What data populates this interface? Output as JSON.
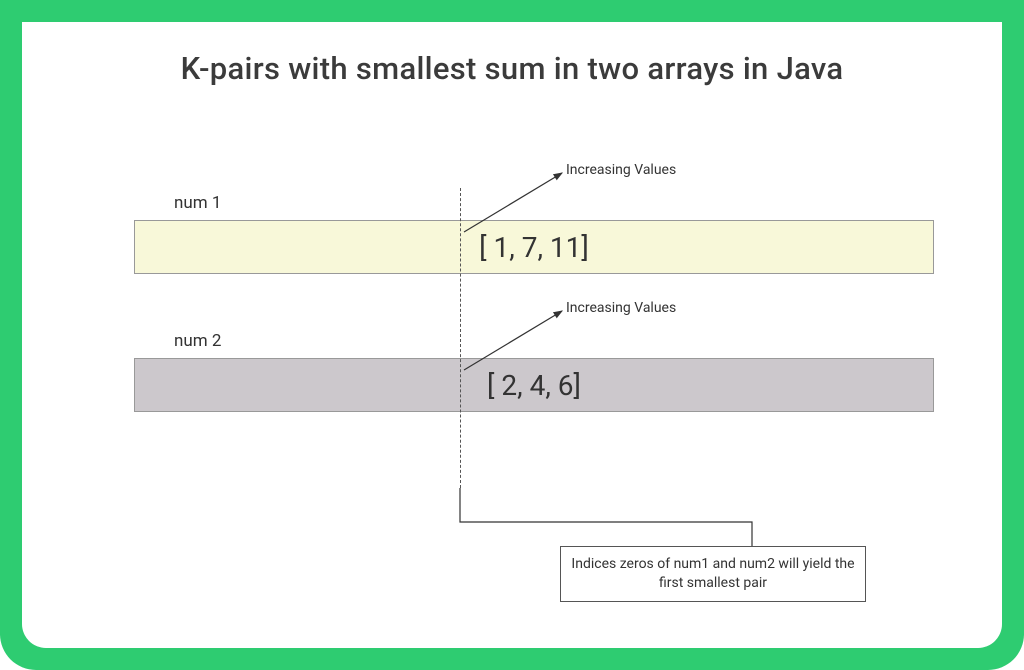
{
  "title": "K-pairs with smallest sum in two arrays in Java",
  "num1": {
    "label": "num 1",
    "values_text": "[ 1, 7, 11]",
    "values": [
      1,
      7,
      11
    ]
  },
  "num2": {
    "label": "num 2",
    "values_text": "[ 2, 4, 6]",
    "values": [
      2,
      4,
      6
    ]
  },
  "annotation_increasing": "Increasing Values",
  "callout_text": "Indices zeros of num1 and num2 will yield the first smallest pair",
  "colors": {
    "frame": "#2ecc71",
    "bar_num1": "#f8f8d9",
    "bar_num2": "#ccc8cc"
  }
}
